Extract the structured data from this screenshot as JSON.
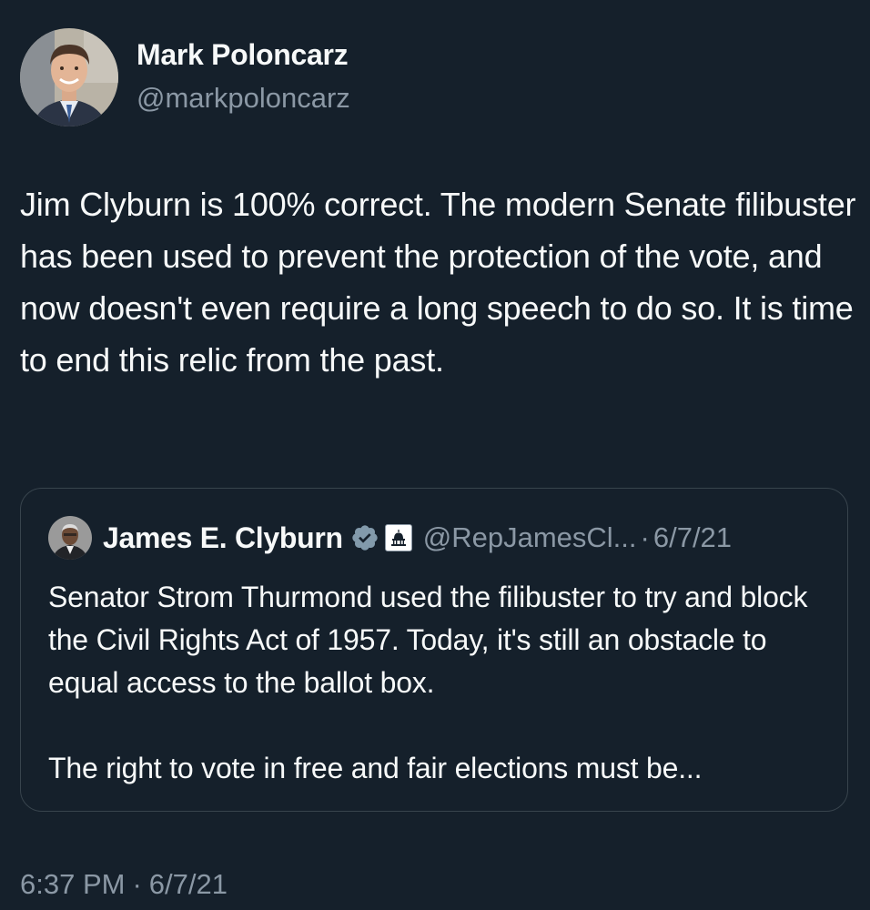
{
  "theme": {
    "background": "#15202b",
    "text_primary": "#f7f9f9",
    "text_secondary": "#8b98a5",
    "border": "#38444d",
    "verified_badge": "#829aab"
  },
  "tweet": {
    "author_name": "Mark Poloncarz",
    "author_handle": "@markpoloncarz",
    "text": "Jim Clyburn is 100% correct. The modern Senate filibuster has been used to prevent the protection of the vote, and now doesn't even require a long speech to do so. It is time to end this relic from the past.",
    "time": "6:37 PM",
    "date": "6/7/21",
    "separator": "·"
  },
  "quoted_tweet": {
    "author_name": "James E. Clyburn",
    "verified_icon": "verified-badge-icon",
    "affiliation_icon": "government-capitol-icon",
    "author_handle": "@RepJamesCl...",
    "separator": "·",
    "date": "6/7/21",
    "text": "Senator Strom Thurmond used the filibuster to try and block the Civil Rights Act of 1957. Today, it's still an obstacle to equal access to the ballot box.",
    "text_continued": "The right to vote in free and fair elections must be..."
  }
}
